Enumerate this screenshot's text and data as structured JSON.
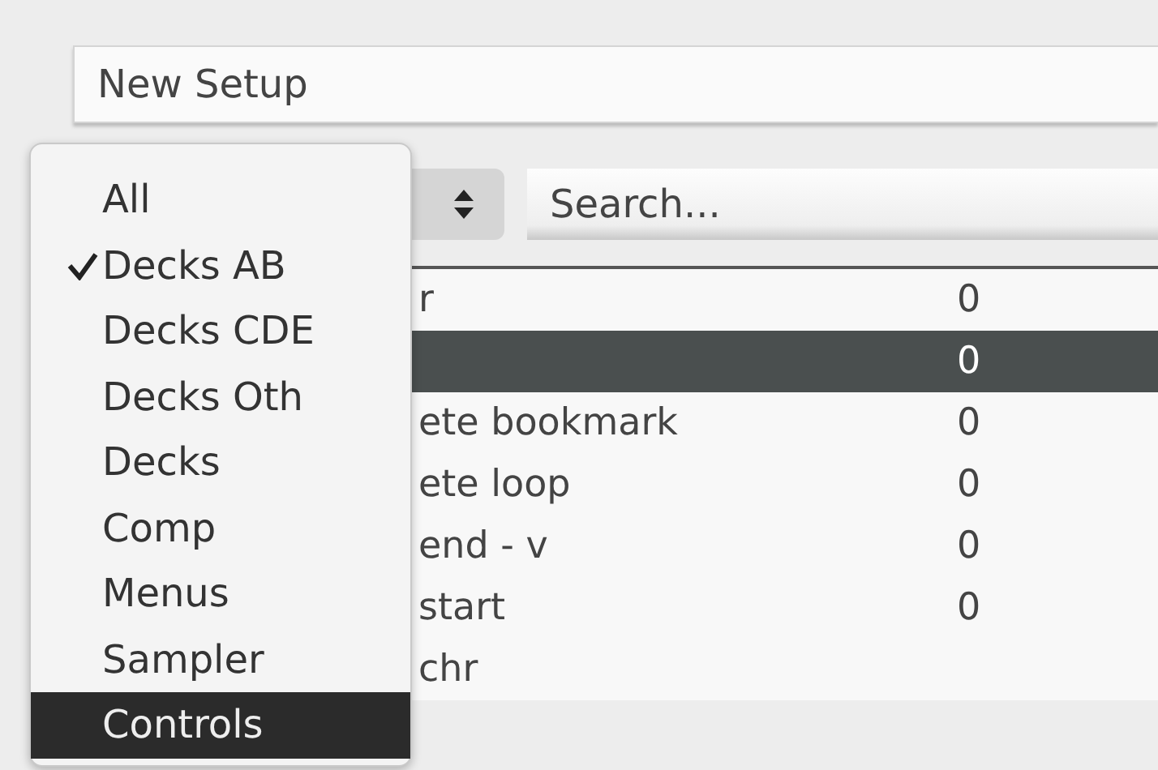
{
  "setup_name": {
    "value": "New Setup"
  },
  "search": {
    "placeholder": "Search..."
  },
  "table": {
    "rows": [
      {
        "name": "r",
        "value": "0",
        "selected": false
      },
      {
        "value": "0",
        "selected": true
      },
      {
        "name": "ete bookmark",
        "value": "0",
        "selected": false
      },
      {
        "name": "ete loop",
        "value": "0",
        "selected": false
      },
      {
        "name": "end - v",
        "value": "0",
        "selected": false
      },
      {
        "name": "start",
        "value": "0",
        "selected": false
      },
      {
        "name": "chr",
        "selected": false
      }
    ]
  },
  "popup_menu": {
    "items": [
      {
        "label": "All",
        "checked": false,
        "selected": false
      },
      {
        "label": "Decks AB",
        "checked": true,
        "selected": false
      },
      {
        "label": "Decks CDE",
        "checked": false,
        "selected": false
      },
      {
        "label": "Decks Oth",
        "checked": false,
        "selected": false
      },
      {
        "label": "Decks",
        "checked": false,
        "selected": false
      },
      {
        "label": "Comp",
        "checked": false,
        "selected": false
      },
      {
        "label": "Menus",
        "checked": false,
        "selected": false
      },
      {
        "label": "Sampler",
        "checked": false,
        "selected": false
      },
      {
        "label": "Controls",
        "checked": false,
        "selected": true
      }
    ]
  }
}
